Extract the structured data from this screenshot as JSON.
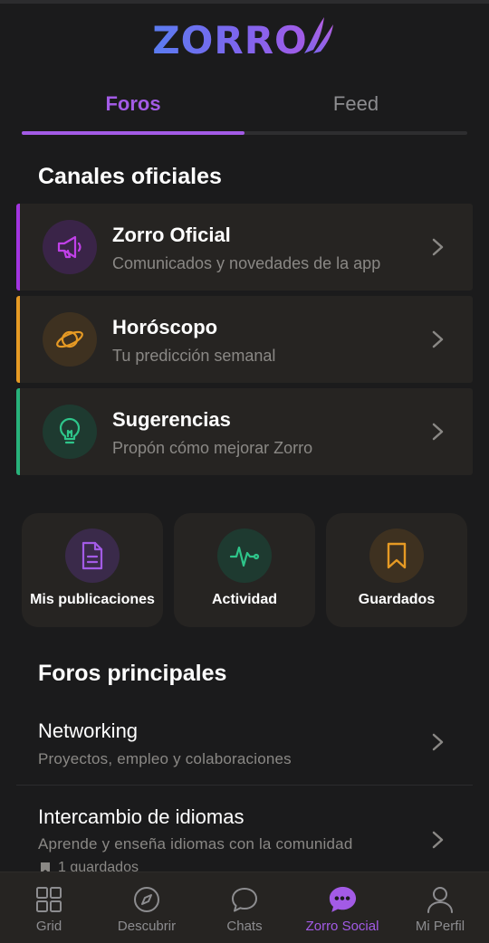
{
  "app": {
    "logo_text": "ZORRO"
  },
  "tabs": [
    {
      "label": "Foros",
      "active": true
    },
    {
      "label": "Feed",
      "active": false
    }
  ],
  "official": {
    "title": "Canales oficiales",
    "channels": [
      {
        "title": "Zorro Oficial",
        "subtitle": "Comunicados y novedades de la app",
        "icon": "megaphone-icon",
        "accent": "#a235e0"
      },
      {
        "title": "Horóscopo",
        "subtitle": "Tu predicción semanal",
        "icon": "planet-icon",
        "accent": "#e69a24"
      },
      {
        "title": "Sugerencias",
        "subtitle": "Propón cómo mejorar Zorro",
        "icon": "lightbulb-icon",
        "accent": "#28b27a"
      }
    ]
  },
  "quick_actions": [
    {
      "label": "Mis publicaciones",
      "icon": "document-icon",
      "color": "#a35be6"
    },
    {
      "label": "Actividad",
      "icon": "activity-icon",
      "color": "#2ec58a"
    },
    {
      "label": "Guardados",
      "icon": "bookmark-icon",
      "color": "#e69a24"
    }
  ],
  "forums": {
    "title": "Foros principales",
    "items": [
      {
        "title": "Networking",
        "subtitle": "Proyectos, empleo y colaboraciones"
      },
      {
        "title": "Intercambio de idiomas",
        "subtitle": "Aprende y enseña idiomas con la comunidad",
        "saved": "1 guardados"
      }
    ]
  },
  "nav": [
    {
      "label": "Grid",
      "icon": "grid-icon",
      "active": false
    },
    {
      "label": "Descubrir",
      "icon": "compass-icon",
      "active": false
    },
    {
      "label": "Chats",
      "icon": "chat-bubble-icon",
      "active": false
    },
    {
      "label": "Zorro Social",
      "icon": "social-dots-icon",
      "active": true
    },
    {
      "label": "Mi Perfil",
      "icon": "user-icon",
      "active": false
    }
  ],
  "colors": {
    "accent": "#a35be6",
    "background": "#1b1b1c",
    "card": "#262422"
  }
}
